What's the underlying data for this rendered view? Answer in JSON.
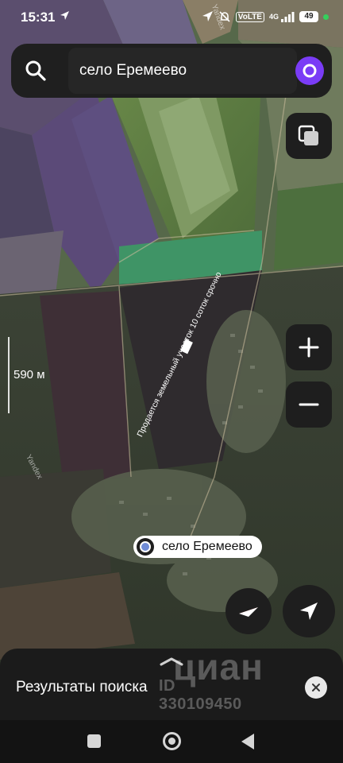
{
  "status_bar": {
    "time": "15:31",
    "net_badge": "VoLTE",
    "network": "4G",
    "battery": "49"
  },
  "search": {
    "query": "село Еремеево",
    "search_icon": "search-icon",
    "assistant_icon": "alice-assistant-icon"
  },
  "map": {
    "scale_label": "590 м",
    "field_caption": "Продается земельный участок 10 соток срочно",
    "provider_watermark": "Yandex",
    "place_label": "село Еремеево",
    "controls": {
      "layers_icon": "layers-icon",
      "zoom_in_icon": "plus-icon",
      "zoom_out_icon": "minus-icon",
      "compass_icon": "compass-icon",
      "locate_icon": "navigation-arrow-icon"
    }
  },
  "bottom_sheet": {
    "title": "Результаты поиска",
    "close_icon": "close-icon"
  },
  "watermark": {
    "brand": "циан",
    "listing_id": "ID 330109450"
  },
  "colors": {
    "panel": "#1f1f1f",
    "accent_purple": "#7a3cf6",
    "compass_red": "#e53935"
  }
}
